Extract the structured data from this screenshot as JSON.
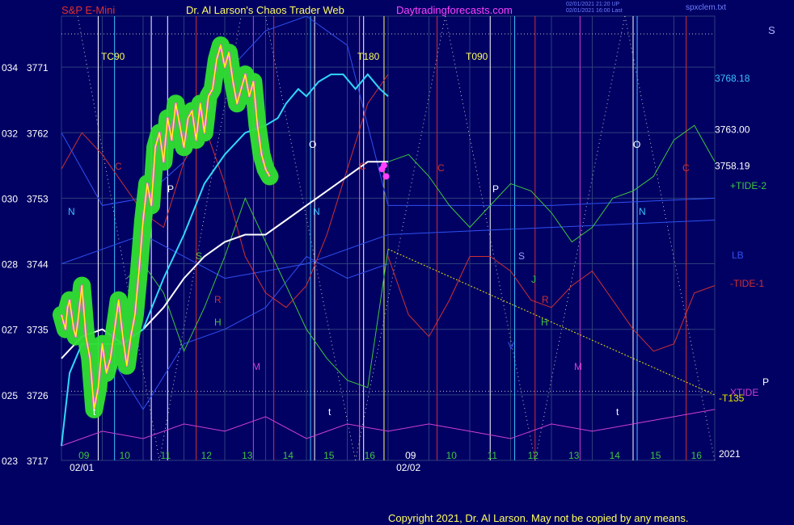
{
  "header": {
    "symbol": "S&P E-Mini",
    "site_title": "Dr. Al Larson's Chaos Trader Web",
    "site_url": "Daytradingforecasts.com",
    "timestamp_1": "02/01/2021 21:20 UP",
    "timestamp_2": "02/01/2021 16:00 Last",
    "file_name": "spxclem.txt",
    "corner_label": "S"
  },
  "copyright": "Copyright 2021, Dr. Al Larson. May not be copied by any means.",
  "colors": {
    "background": "#010164",
    "grid": "#2c3f7a",
    "price": "#ffff00",
    "price_highlight": "#ff40ff",
    "price_glow": "#30e030",
    "average_fast": "#30d8f8",
    "average_slow": "#ffffff",
    "tide_plus": "#3fc63f",
    "tide_minus": "#d03030",
    "lunar_band": "#3050f0",
    "magenta_cycle": "#d040d0",
    "forecast": "#e6e600"
  },
  "chart_data": {
    "type": "line",
    "ylim": [
      3717,
      3778
    ],
    "y_ticks": [
      {
        "value": 3771,
        "left": "034",
        "right": "3771"
      },
      {
        "value": 3762,
        "left": "032",
        "right": "3762"
      },
      {
        "value": 3753,
        "left": "030",
        "right": "3753"
      },
      {
        "value": 3744,
        "left": "028",
        "right": "3744"
      },
      {
        "value": 3735,
        "left": "027",
        "right": "3735"
      },
      {
        "value": 3726,
        "left": "025",
        "right": "3726"
      },
      {
        "value": 3717,
        "left": "023",
        "right": "3717"
      }
    ],
    "x_hour_ticks": [
      "09",
      "10",
      "11",
      "12",
      "13",
      "14",
      "15",
      "16",
      "09",
      "10",
      "11",
      "12",
      "13",
      "14",
      "15",
      "16"
    ],
    "x_date_labels": [
      "02/01",
      "02/02"
    ],
    "year_label": "2021",
    "right_price_labels": [
      "3768.18",
      "3763.00",
      "3758.19"
    ],
    "right_series_labels": [
      {
        "text": "+TIDE-2",
        "color": "#3fc63f"
      },
      {
        "text": "LB",
        "color": "#3050f0"
      },
      {
        "text": "-TIDE-1",
        "color": "#d03030"
      },
      {
        "text": "XTIDE",
        "color": "#d040d0"
      },
      {
        "text": "-T135",
        "color": "#e6e600"
      },
      {
        "text": "P",
        "color": "#ffffff"
      }
    ],
    "cycle_labels": [
      {
        "text": "TC90",
        "color": "#ffff60"
      },
      {
        "text": "T180",
        "color": "#ffff60"
      },
      {
        "text": "T090",
        "color": "#ffff60"
      },
      {
        "text": "N",
        "color": "#3cc0ff"
      },
      {
        "text": "C",
        "color": "#d03030"
      },
      {
        "text": "P",
        "color": "#ffffff"
      },
      {
        "text": "S",
        "color": "#3fc63f"
      },
      {
        "text": "R",
        "color": "#d03030"
      },
      {
        "text": "H",
        "color": "#3fc63f"
      },
      {
        "text": "M",
        "color": "#d040d0"
      },
      {
        "text": "O",
        "color": "#ffffff"
      },
      {
        "text": "N",
        "color": "#3cc0ff"
      },
      {
        "text": "C",
        "color": "#d03030"
      },
      {
        "text": "C",
        "color": "#d03030"
      },
      {
        "text": "P",
        "color": "#ffffff"
      },
      {
        "text": "S",
        "color": "#a0a0ff"
      },
      {
        "text": "J",
        "color": "#3fc63f"
      },
      {
        "text": "R",
        "color": "#d03030"
      },
      {
        "text": "H",
        "color": "#3fc63f"
      },
      {
        "text": "V",
        "color": "#3050f0"
      },
      {
        "text": "M",
        "color": "#d040d0"
      },
      {
        "text": "O",
        "color": "#ffffff"
      },
      {
        "text": "N",
        "color": "#3cc0ff"
      },
      {
        "text": "C",
        "color": "#d03030"
      },
      {
        "text": "t",
        "color": "#ffffff"
      },
      {
        "text": "t",
        "color": "#ffffff"
      },
      {
        "text": "t",
        "color": "#ffffff"
      }
    ],
    "price": {
      "x": [
        0,
        0.05,
        0.1,
        0.15,
        0.2,
        0.25,
        0.3,
        0.35,
        0.4,
        0.5,
        0.6,
        0.7,
        0.8,
        0.9,
        1,
        1.1,
        1.2,
        1.3,
        1.4,
        1.5,
        1.6,
        1.7,
        1.8,
        1.9,
        2,
        2.1,
        2.2,
        2.3,
        2.4,
        2.5,
        2.6,
        2.7,
        2.8,
        2.9,
        3,
        3.1,
        3.2,
        3.3,
        3.4,
        3.5,
        3.6,
        3.7,
        3.8,
        3.9,
        4,
        4.1,
        4.2,
        4.3,
        4.4,
        4.5,
        4.6,
        4.7,
        4.8,
        4.9,
        5,
        5.1,
        5.2,
        5.3,
        5.4,
        5.5,
        5.6,
        5.7,
        5.8,
        5.9,
        6,
        6.1,
        6.2,
        6.3,
        6.4,
        6.5,
        6.6,
        6.7,
        6.8,
        6.9,
        7,
        7.1,
        7.2,
        7.3,
        7.4,
        7.5,
        7.6,
        7.7,
        7.8,
        7.9,
        8
      ],
      "values": [
        3737,
        3736,
        3735,
        3738,
        3739,
        3737,
        3735,
        3734,
        3736,
        3741,
        3734,
        3731,
        3724,
        3727,
        3733,
        3729,
        3731,
        3735,
        3739,
        3734,
        3730,
        3734,
        3737,
        3743,
        3750,
        3755,
        3752,
        3760,
        3762,
        3758,
        3764,
        3761,
        3766,
        3763,
        3760,
        3764,
        3765,
        3761,
        3766,
        3762,
        3767,
        3768,
        3772,
        3774,
        3771,
        3773,
        3769,
        3766,
        3768,
        3770,
        3767,
        3769,
        3763,
        3759,
        3757,
        3756
      ]
    },
    "average_fast": {
      "x": [
        0,
        0.2,
        0.5,
        1,
        1.5,
        2,
        2.5,
        3,
        3.5,
        4,
        4.5,
        5,
        5.3,
        5.5,
        5.8,
        6,
        6.3,
        6.6,
        6.9,
        7.2,
        7.5,
        7.8,
        8
      ],
      "values": [
        3719,
        3729,
        3733,
        3733,
        3733,
        3735,
        3742,
        3748,
        3755,
        3759,
        3762,
        3763,
        3764,
        3766,
        3768,
        3767,
        3769,
        3770,
        3770,
        3768,
        3770,
        3768,
        3767
      ]
    },
    "average_slow": {
      "x": [
        0,
        0.5,
        1,
        1.5,
        2,
        2.5,
        3,
        3.5,
        4,
        4.5,
        5,
        5.5,
        6,
        6.5,
        7,
        7.5,
        8
      ],
      "values": [
        3731,
        3734,
        3735,
        3733,
        3735,
        3738,
        3742,
        3745,
        3747,
        3748,
        3748,
        3750,
        3752,
        3754,
        3756,
        3758,
        3758
      ]
    },
    "tide_plus_2": {
      "x": [
        8,
        8.5,
        9,
        9.5,
        10,
        10.5,
        11,
        11.5,
        12,
        12.5,
        13,
        13.5,
        14,
        14.5,
        15,
        15.5,
        16
      ],
      "values": [
        3758,
        3759,
        3756,
        3752,
        3749,
        3752,
        3755,
        3754,
        3751,
        3747,
        3749,
        3753,
        3754,
        3756,
        3761,
        3763,
        3758
      ]
    },
    "tide_minus_1": {
      "x": [
        8,
        8.5,
        9,
        9.5,
        10,
        10.5,
        11,
        11.5,
        12,
        12.5,
        13,
        13.5,
        14,
        14.5,
        15,
        15.5,
        16
      ],
      "values": [
        3745,
        3737,
        3734,
        3739,
        3745,
        3745,
        3743,
        3739,
        3738,
        3741,
        3743,
        3739,
        3735,
        3732,
        3733,
        3740,
        3741
      ]
    },
    "xtide": {
      "x": [
        0,
        1,
        2,
        3,
        4,
        5,
        6,
        7,
        8,
        9,
        10,
        11,
        12,
        13,
        14,
        15,
        16
      ],
      "values": [
        3719,
        3721,
        3720,
        3722,
        3721,
        3723,
        3720,
        3722,
        3721,
        3722,
        3721,
        3720,
        3722,
        3721,
        3722,
        3723,
        3724
      ]
    },
    "forecast_t135": {
      "x": [
        8,
        16
      ],
      "values": [
        3746,
        3726
      ]
    }
  }
}
